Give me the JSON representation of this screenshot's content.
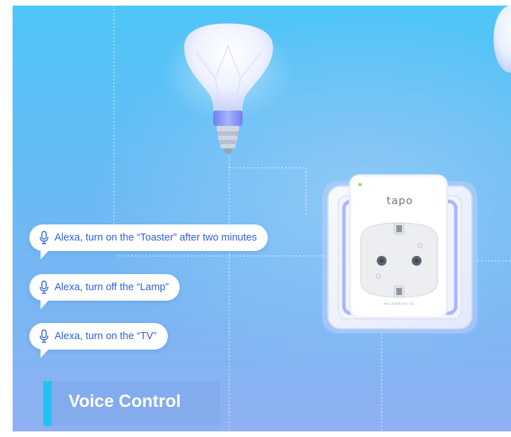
{
  "brand_logo": "tapo",
  "plug_rating": "MAX 3680W  MAX 16A",
  "voice_commands": [
    {
      "text": "Alexa, turn on the “Toaster” after two minutes",
      "icon": "microphone-icon"
    },
    {
      "text": "Alexa, turn off the “Lamp”",
      "icon": "microphone-icon"
    },
    {
      "text": "Alexa, turn on the “TV”",
      "icon": "microphone-icon"
    }
  ],
  "feature_title": "Voice Control",
  "colors": {
    "bubble_text": "#2f5fd6",
    "accent_bar": "#21c3f0",
    "background_top": "#4fc6f7",
    "background_bottom": "#8fb1f3",
    "led": "#7ee34a"
  }
}
